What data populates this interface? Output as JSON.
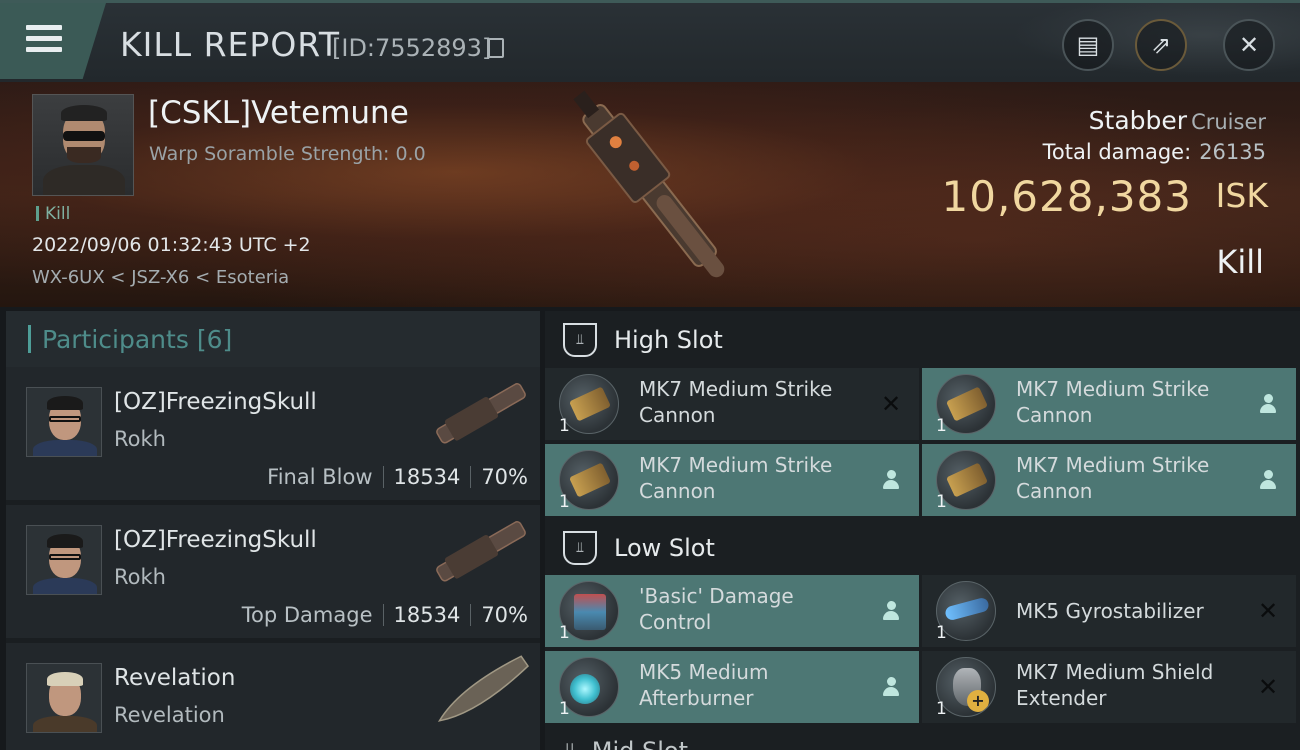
{
  "header": {
    "title": "KILL REPORT",
    "report_id": "[ID:7552893]",
    "menu_icon": "hamburger-menu-icon",
    "buttons": [
      {
        "name": "clipboard-icon",
        "glyph": "▤"
      },
      {
        "name": "share-icon",
        "glyph": "⇗"
      },
      {
        "name": "close-icon",
        "glyph": "✕"
      }
    ]
  },
  "victim": {
    "name": "[CSKL]Vetemune",
    "scramble": "Warp Soramble Strength: 0.0",
    "tag": "Kill",
    "datetime": "2022/09/06 01:32:43 UTC +2",
    "location": "WX-6UX < JSZ-X6 < Esoteria",
    "ship_name": "Stabber",
    "ship_class": "Cruiser",
    "total_damage_label": "Total damage:",
    "total_damage": "26135",
    "isk_value": "10,628,383",
    "isk_unit": "ISK",
    "result": "Kill"
  },
  "participants": {
    "title": "Participants",
    "count": "[6]",
    "items": [
      {
        "name": "[OZ]FreezingSkull",
        "ship": "Rokh",
        "label": "Final Blow",
        "damage": "18534",
        "percent": "70%"
      },
      {
        "name": "[OZ]FreezingSkull",
        "ship": "Rokh",
        "label": "Top Damage",
        "damage": "18534",
        "percent": "70%"
      },
      {
        "name": "Revelation",
        "ship": "Revelation"
      }
    ]
  },
  "slots": {
    "high": {
      "title": "High Slot",
      "modules": [
        {
          "line1": "MK7 Medium Strike",
          "line2": "Cannon",
          "qty": "1",
          "status": "destroyed"
        },
        {
          "line1": "MK7 Medium Strike",
          "line2": "Cannon",
          "qty": "1",
          "status": "dropped"
        },
        {
          "line1": "MK7 Medium Strike",
          "line2": "Cannon",
          "qty": "1",
          "status": "dropped"
        },
        {
          "line1": "MK7 Medium Strike",
          "line2": "Cannon",
          "qty": "1",
          "status": "dropped"
        }
      ]
    },
    "low": {
      "title": "Low Slot",
      "modules": [
        {
          "line1": "'Basic' Damage",
          "line2": "Control",
          "qty": "1",
          "status": "dropped"
        },
        {
          "line1": "MK5 Gyrostabilizer",
          "line2": "",
          "qty": "1",
          "status": "destroyed"
        },
        {
          "line1": "MK5 Medium",
          "line2": "Afterburner",
          "qty": "1",
          "status": "dropped"
        },
        {
          "line1": "MK7 Medium Shield",
          "line2": "Extender",
          "qty": "1",
          "status": "destroyed"
        }
      ]
    },
    "mid": {
      "title": "Mid Slot"
    }
  }
}
